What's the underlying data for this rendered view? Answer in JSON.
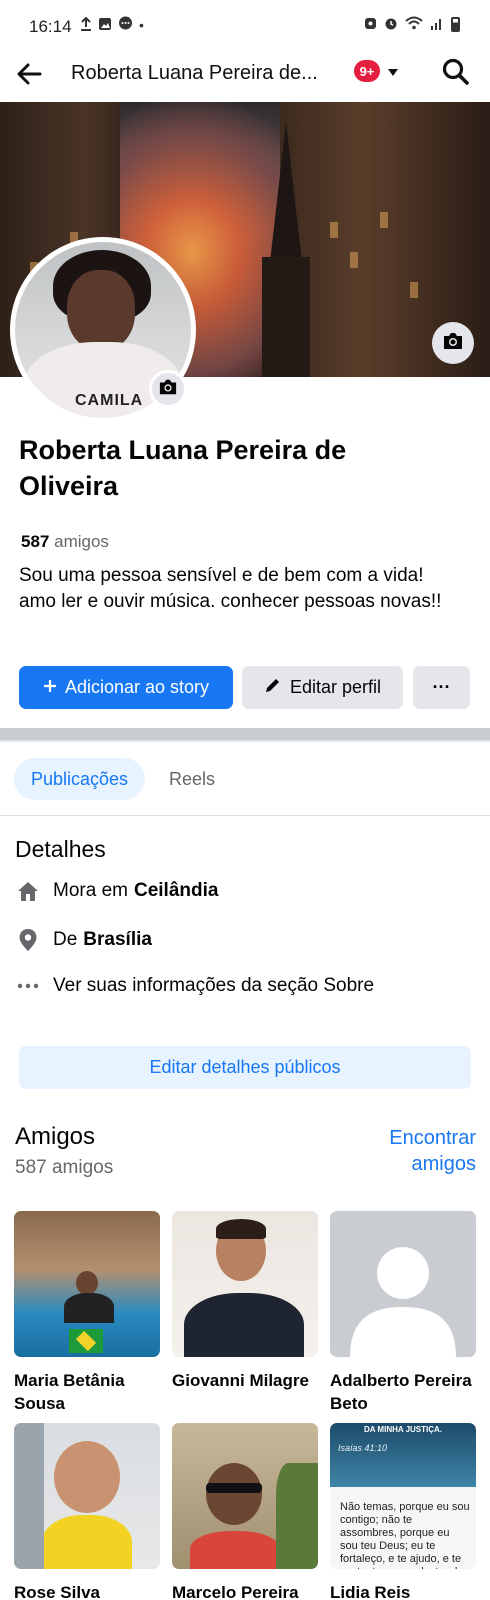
{
  "status_bar": {
    "time": "16:14",
    "left_icons": [
      "upload-icon",
      "image-icon",
      "messenger-icon",
      "dot-icon"
    ],
    "right_icons": [
      "nfc-icon",
      "alarm-icon",
      "wifi-icon",
      "signal-icon",
      "battery-icon"
    ]
  },
  "nav": {
    "title": "Roberta Luana Pereira de...",
    "badge": "9+",
    "accent": "#e41e3f"
  },
  "profile": {
    "name": "Roberta Luana Pereira de Oliveira",
    "friends_count": "587",
    "friends_label": "amigos",
    "bio": "Sou uma pessoa sensível e de bem com a vida! amo ler e ouvir música. conhecer pessoas novas!!",
    "avatar_text": "CAMILA"
  },
  "actions": {
    "add_story": "Adicionar ao story",
    "edit_profile": "Editar perfil",
    "more": "···"
  },
  "tabs": [
    {
      "label": "Publicações",
      "active": true
    },
    {
      "label": "Reels",
      "active": false
    }
  ],
  "details": {
    "title": "Detalhes",
    "lives_prefix": "Mora em",
    "lives_place": "Ceilândia",
    "from_prefix": "De",
    "from_place": "Brasília",
    "about_link": "Ver suas informações da seção Sobre",
    "edit_button": "Editar detalhes públicos"
  },
  "friends": {
    "title": "Amigos",
    "subtitle": "587 amigos",
    "find_link": "Encontrar amigos",
    "list": [
      {
        "name": "Maria Betânia Sousa"
      },
      {
        "name": "Giovanni Milagre"
      },
      {
        "name": "Adalberto Pereira Beto"
      },
      {
        "name": "Rose Silva"
      },
      {
        "name": "Marcelo Pereira"
      },
      {
        "name": "Lidia Reis"
      }
    ],
    "lidia_post": {
      "heading": "DA MINHA JUSTIÇA.",
      "reference": "Isaías 41:10",
      "verse": "Não temas, porque eu sou contigo; não te assombres, porque eu sou teu Deus; eu te fortaleço, e te ajudo, e te sustento com a destra da"
    }
  },
  "colors": {
    "primary": "#1877f2",
    "secondary_bg": "#e4e6eb",
    "light_blue_bg": "#e7f3ff",
    "muted_text": "#65676b"
  }
}
